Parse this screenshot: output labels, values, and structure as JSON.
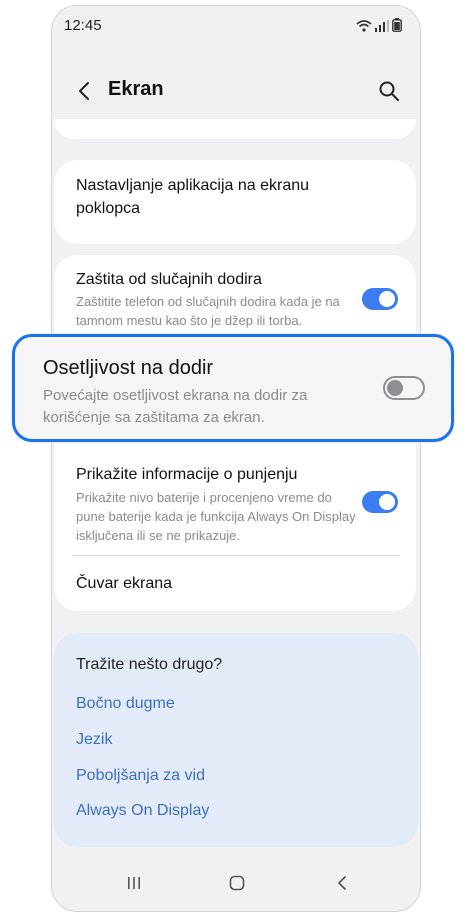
{
  "status": {
    "time": "12:45"
  },
  "header": {
    "title": "Ekran"
  },
  "settings": {
    "cover_apps": "Nastavljanje aplikacija na ekranu poklopca",
    "accidental_touch": {
      "title": "Zaštita od slučajnih dodira",
      "subtitle": "Zaštitite telefon od slučajnih dodira kada je na tamnom mestu kao što je džep ili torba.",
      "enabled": true
    },
    "touch_sensitivity": {
      "title": "Osetljivost na dodir",
      "subtitle": "Povećajte osetljivost ekrana na dodir za korišćenje sa zaštitama za ekran.",
      "enabled": false
    },
    "charging_info": {
      "title": "Prikažite informacije o punjenju",
      "subtitle": "Prikažite nivo baterije i procenjeno vreme do pune baterije kada je funkcija Always On Display isključena ili se ne prikazuje.",
      "enabled": true
    },
    "screen_saver": "Čuvar ekrana"
  },
  "suggestions": {
    "title": "Tražite nešto drugo?",
    "links": [
      "Bočno dugme",
      "Jezik",
      "Poboljšanja za vid",
      "Always On Display"
    ]
  },
  "colors": {
    "accent": "#3b7df0",
    "link": "#3e6fbe",
    "highlight": "#1a73e8"
  }
}
